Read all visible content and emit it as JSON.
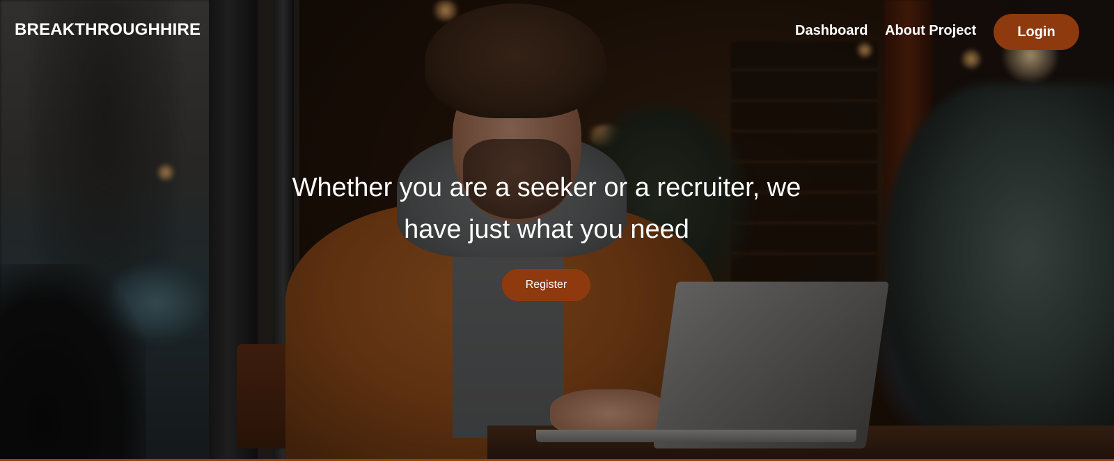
{
  "brand": "BREAKTHROUGHHIRE",
  "nav": {
    "dashboard": "Dashboard",
    "about": "About Project",
    "login": "Login"
  },
  "hero": {
    "headline": "Whether you are a seeker or a recruiter, we have just what you need",
    "register": "Register"
  },
  "colors": {
    "accent": "#8f3a0e",
    "text": "#ffffff"
  }
}
